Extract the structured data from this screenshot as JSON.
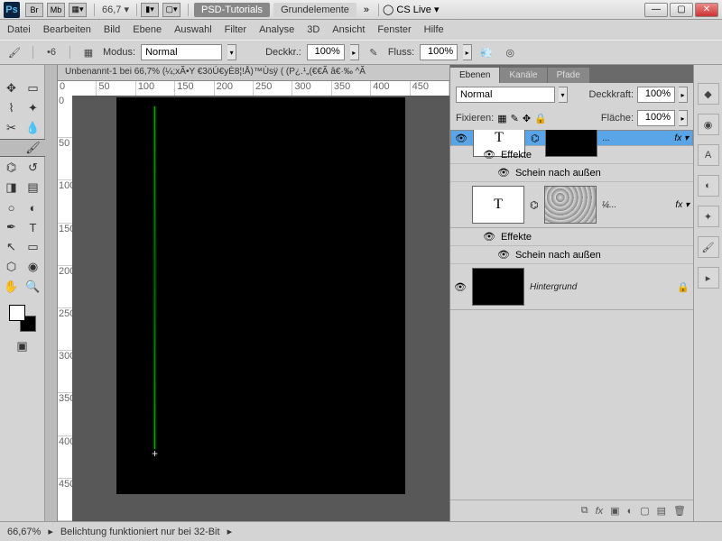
{
  "title": {
    "psd_tutorials": "PSD-Tutorials",
    "grundelemente": "Grundelemente",
    "zoom": "66,7",
    "cslive": "CS Live"
  },
  "tb_btns": {
    "br": "Br",
    "mb": "Mb"
  },
  "menu": [
    "Datei",
    "Bearbeiten",
    "Bild",
    "Ebene",
    "Auswahl",
    "Filter",
    "Analyse",
    "3D",
    "Ansicht",
    "Fenster",
    "Hilfe"
  ],
  "opt": {
    "size": "6",
    "modus_lbl": "Modus:",
    "modus": "Normal",
    "deckkr_lbl": "Deckkr.:",
    "deckkr": "100%",
    "fluss_lbl": "Fluss:",
    "fluss": "100%"
  },
  "doc": {
    "tab": "Unbenannt-1 bei 66,7% (¼;xÃ•Y €3öÚ€yÈ8¦!Å)™Ùsÿ      (  (P¿.¹„(€€Ã â€·‰ ^Ã",
    "rulerH": [
      "0",
      "50",
      "100",
      "150",
      "200",
      "250",
      "300",
      "350",
      "400",
      "450"
    ],
    "rulerV": [
      "0",
      "50",
      "100",
      "150",
      "200",
      "250",
      "300",
      "350",
      "400",
      "450"
    ]
  },
  "layers_panel": {
    "tabs": [
      "Ebenen",
      "Kanäle",
      "Pfade"
    ],
    "blend": "Normal",
    "deck_lbl": "Deckkraft:",
    "deck": "100%",
    "fix_lbl": "Fixieren:",
    "flaeche_lbl": "Fläche:",
    "flaeche": "100%",
    "layers": [
      {
        "t": "T",
        "name": "...",
        "fx": "fx",
        "sel": true,
        "mask": "blk",
        "effects": [
          "Effekte",
          "Schein nach außen"
        ]
      },
      {
        "t": "T",
        "name": "¼...",
        "fx": "fx",
        "sel": false,
        "mask": "tex",
        "effects": [
          "Effekte",
          "Schein nach außen"
        ]
      },
      {
        "t": "",
        "name": "Hintergrund",
        "fx": "",
        "sel": false,
        "mask": "",
        "bg": true
      }
    ]
  },
  "status": {
    "zoom": "66,67%",
    "msg": "Belichtung funktioniert nur bei 32-Bit"
  }
}
